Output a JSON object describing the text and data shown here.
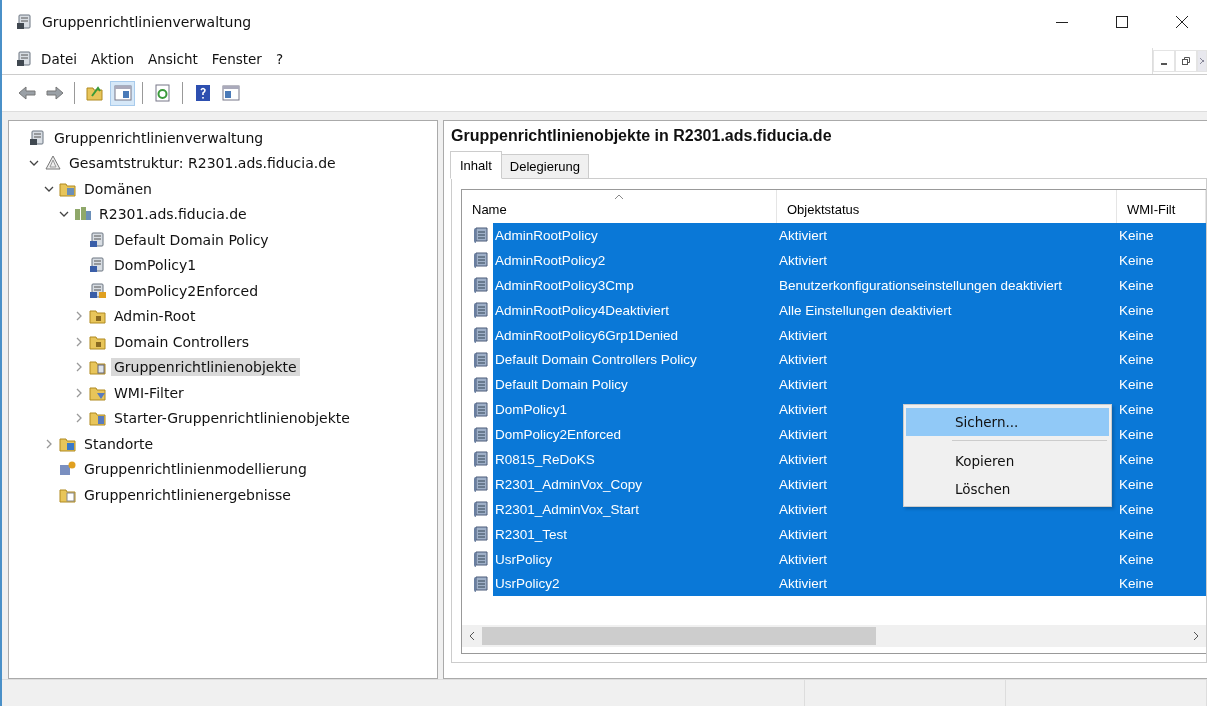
{
  "window": {
    "title": "Gruppenrichtlinienverwaltung"
  },
  "menu": [
    "Datei",
    "Aktion",
    "Ansicht",
    "Fenster",
    "?"
  ],
  "toolbar": [
    {
      "kind": "back"
    },
    {
      "kind": "forward"
    },
    {
      "kind": "sep"
    },
    {
      "kind": "up"
    },
    {
      "kind": "tree",
      "selected": true
    },
    {
      "kind": "sep"
    },
    {
      "kind": "refresh"
    },
    {
      "kind": "sep"
    },
    {
      "kind": "help"
    },
    {
      "kind": "pane"
    }
  ],
  "tree": [
    {
      "label": "Gruppenrichtlinienverwaltung",
      "kind": "console",
      "selected": false,
      "children": [
        {
          "label": "Gesamtstruktur: R2301.ads.fiducia.de",
          "kind": "forest",
          "expanded": true,
          "selected": false,
          "children": [
            {
              "label": "Domänen",
              "kind": "domains",
              "expanded": true,
              "selected": false,
              "children": [
                {
                  "label": "R2301.ads.fiducia.de",
                  "kind": "domain",
                  "expanded": true,
                  "selected": false,
                  "children": [
                    {
                      "label": "Default Domain Policy",
                      "kind": "link",
                      "selected": false
                    },
                    {
                      "label": "DomPolicy1",
                      "kind": "link",
                      "selected": false
                    },
                    {
                      "label": "DomPolicy2Enforced",
                      "kind": "enforced",
                      "selected": false
                    },
                    {
                      "label": "Admin-Root",
                      "kind": "ou",
                      "expanded": false,
                      "selected": false
                    },
                    {
                      "label": "Domain Controllers",
                      "kind": "ou",
                      "expanded": false,
                      "selected": false
                    },
                    {
                      "label": "Gruppenrichtlinienobjekte",
                      "kind": "gpos",
                      "expanded": false,
                      "selected": true
                    },
                    {
                      "label": "WMI-Filter",
                      "kind": "wmi",
                      "expanded": false,
                      "selected": false
                    },
                    {
                      "label": "Starter-Gruppenrichtlinienobjekte",
                      "kind": "starter",
                      "expanded": false,
                      "selected": false
                    }
                  ]
                }
              ]
            },
            {
              "label": "Standorte",
              "kind": "sites",
              "expanded": false,
              "selected": false
            },
            {
              "label": "Gruppenrichtlinienmodellierung",
              "kind": "modeling",
              "selected": false
            },
            {
              "label": "Gruppenrichtlinienergebnisse",
              "kind": "results",
              "selected": false
            }
          ]
        }
      ]
    }
  ],
  "panel": {
    "title": "Gruppenrichtlinienobjekte in R2301.ads.fiducia.de",
    "tabs": [
      {
        "label": "Inhalt",
        "selected": true
      },
      {
        "label": "Delegierung",
        "selected": false
      }
    ],
    "table": {
      "columns": [
        "Name",
        "Objektstatus",
        "WMI-Filt"
      ],
      "rows": [
        {
          "cells": [
            "AdminRootPolicy",
            "Aktiviert",
            "Keine"
          ],
          "selected": true
        },
        {
          "cells": [
            "AdminRootPolicy2",
            "Aktiviert",
            "Keine"
          ],
          "selected": true
        },
        {
          "cells": [
            "AdminRootPolicy3Cmp",
            "Benutzerkonfigurationseinstellungen deaktiviert",
            "Keine"
          ],
          "selected": true
        },
        {
          "cells": [
            "AdminRootPolicy4Deaktiviert",
            "Alle Einstellungen deaktiviert",
            "Keine"
          ],
          "selected": true
        },
        {
          "cells": [
            "AdminRootPolicy6Grp1Denied",
            "Aktiviert",
            "Keine"
          ],
          "selected": true
        },
        {
          "cells": [
            "Default Domain Controllers Policy",
            "Aktiviert",
            "Keine"
          ],
          "selected": true
        },
        {
          "cells": [
            "Default Domain Policy",
            "Aktiviert",
            "Keine"
          ],
          "selected": true
        },
        {
          "cells": [
            "DomPolicy1",
            "Aktiviert",
            "Keine"
          ],
          "selected": true
        },
        {
          "cells": [
            "DomPolicy2Enforced",
            "Aktiviert",
            "Keine"
          ],
          "selected": true
        },
        {
          "cells": [
            "R0815_ReDoKS",
            "Aktiviert",
            "Keine"
          ],
          "selected": true
        },
        {
          "cells": [
            "R2301_AdminVox_Copy",
            "Aktiviert",
            "Keine"
          ],
          "selected": true
        },
        {
          "cells": [
            "R2301_AdminVox_Start",
            "Aktiviert",
            "Keine"
          ],
          "selected": true
        },
        {
          "cells": [
            "R2301_Test",
            "Aktiviert",
            "Keine"
          ],
          "selected": true
        },
        {
          "cells": [
            "UsrPolicy",
            "Aktiviert",
            "Keine"
          ],
          "selected": true
        },
        {
          "cells": [
            "UsrPolicy2",
            "Aktiviert",
            "Keine"
          ],
          "selected": true
        }
      ]
    }
  },
  "context_menu": [
    {
      "kind": "item",
      "label": "Sichern...",
      "selected": true
    },
    {
      "kind": "separator"
    },
    {
      "kind": "item",
      "label": "Kopieren",
      "selected": false
    },
    {
      "kind": "item",
      "label": "Löschen",
      "selected": false
    }
  ]
}
